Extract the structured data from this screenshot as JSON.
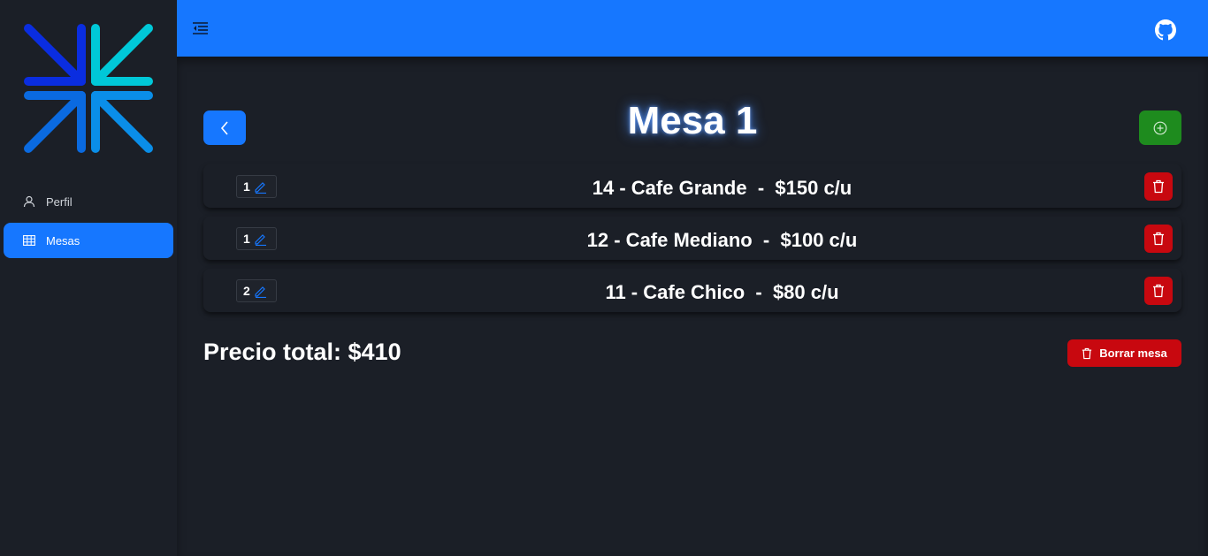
{
  "sidebar": {
    "items": [
      {
        "label": "Perfil",
        "icon": "user-icon",
        "active": false
      },
      {
        "label": "Mesas",
        "icon": "table-icon",
        "active": true
      }
    ]
  },
  "header": {
    "menu_icon": "menu-fold-icon",
    "github_icon": "github-icon"
  },
  "main": {
    "title": "Mesa 1",
    "back_icon": "chevron-left-icon",
    "add_icon": "plus-circle-icon",
    "orders": [
      {
        "quantity": "1",
        "item": "14 - Cafe Grande",
        "price": "$150 c/u"
      },
      {
        "quantity": "1",
        "item": "12 - Cafe Mediano",
        "price": "$100 c/u"
      },
      {
        "quantity": "2",
        "item": "11 - Cafe Chico",
        "price": "$80 c/u"
      }
    ],
    "total_label": "Precio total: $410",
    "clear_button_label": "Borrar mesa"
  },
  "colors": {
    "primary": "#1677ff",
    "success": "#1e8b1e",
    "danger": "#c8080f",
    "background": "#1b1f27"
  }
}
